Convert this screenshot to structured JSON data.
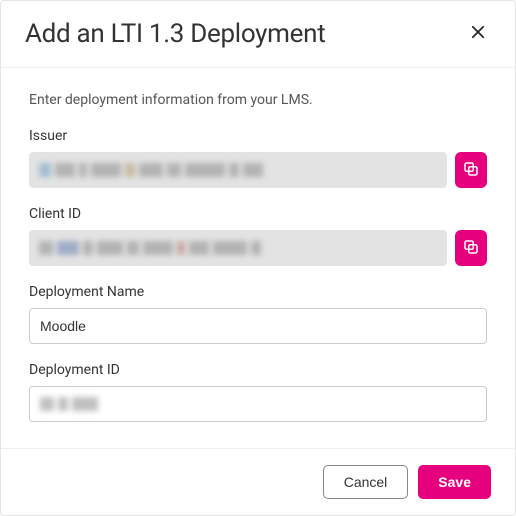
{
  "dialog": {
    "title": "Add an LTI 1.3 Deployment",
    "intro": "Enter deployment information from your LMS."
  },
  "fields": {
    "issuer": {
      "label": "Issuer"
    },
    "client_id": {
      "label": "Client ID"
    },
    "deployment_name": {
      "label": "Deployment Name",
      "value": "Moodle"
    },
    "deployment_id": {
      "label": "Deployment ID",
      "value": ""
    }
  },
  "actions": {
    "cancel_label": "Cancel",
    "save_label": "Save"
  },
  "colors": {
    "accent": "#e6007e"
  }
}
